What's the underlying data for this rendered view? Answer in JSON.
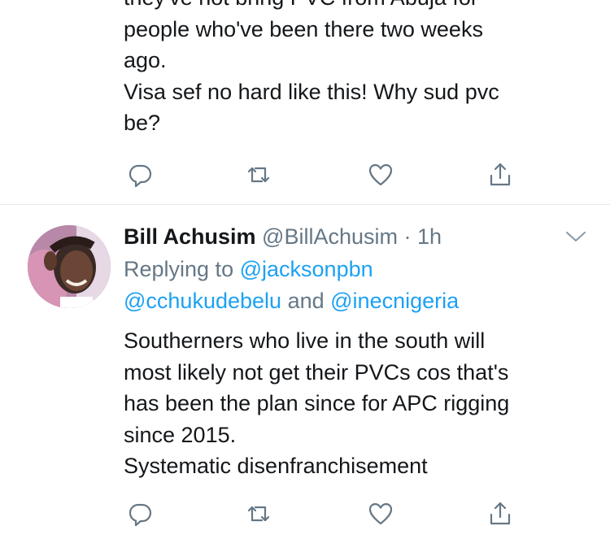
{
  "previous_tweet": {
    "text": "they've not bring PVC from Abuja for\npeople who've been there two weeks\nago.\nVisa sef no hard like this! Why sud pvc\nbe?"
  },
  "tweet": {
    "name": "Bill Achusim",
    "handle": "@BillAchusim",
    "separator": "·",
    "time": "1h",
    "replying_prefix": "Replying to",
    "replying_to_1": "@jacksonpbn",
    "replying_to_2": "@cchukudebelu",
    "replying_conjunction": "and",
    "replying_to_3": "@inecnigeria",
    "text": "Southerners who live in the south will\nmost likely not get their PVCs cos that's\nhas been the plan since for APC rigging\nsince 2015.\nSystematic disenfranchisement"
  },
  "actions": {
    "reply_icon": "reply-icon",
    "retweet_icon": "retweet-icon",
    "like_icon": "like-icon",
    "share_icon": "share-icon"
  },
  "colors": {
    "text": "#14171a",
    "secondary": "#657786",
    "link": "#1da1f2",
    "divider": "#e1e8ed"
  }
}
